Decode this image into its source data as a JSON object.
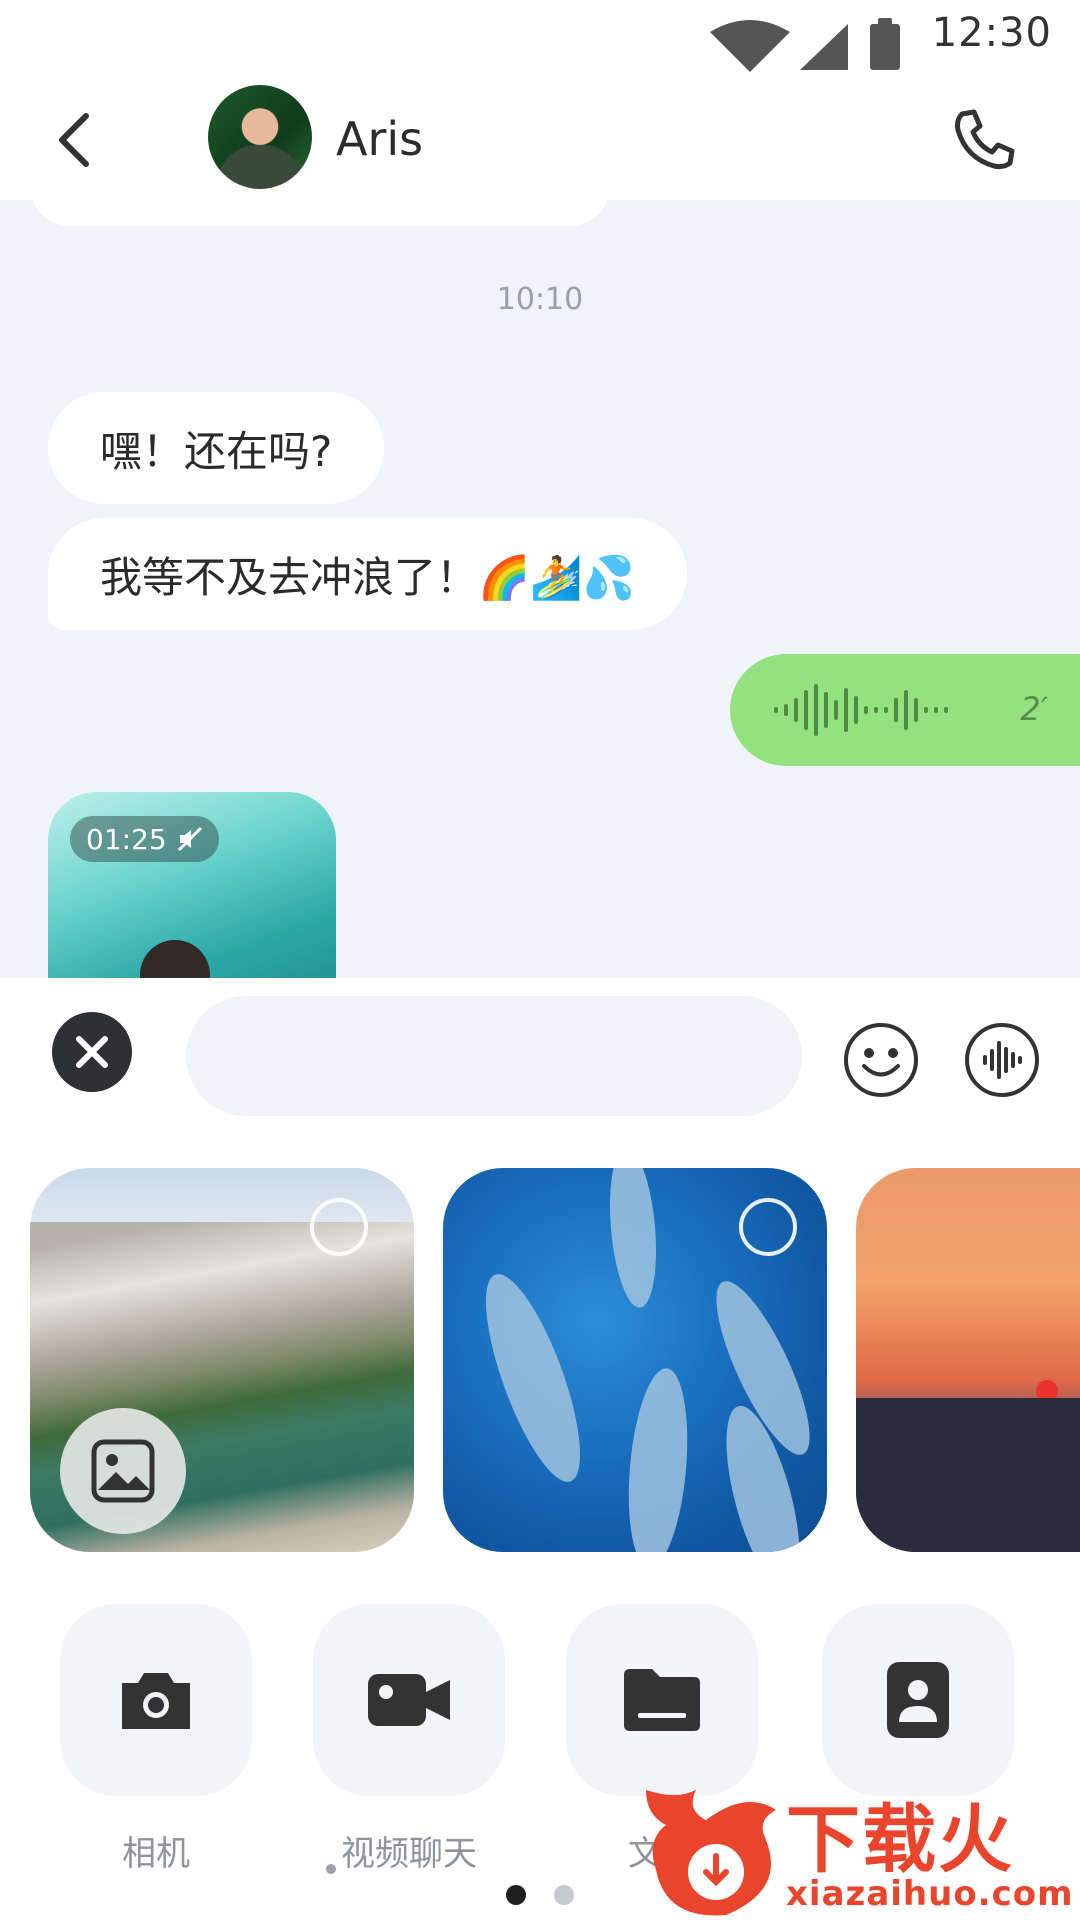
{
  "status_bar": {
    "time": "12:30"
  },
  "header": {
    "contact_name": "Aris"
  },
  "chat": {
    "timestamp": "10:10",
    "messages": [
      {
        "direction": "incoming",
        "text": "嘿！还在吗?"
      },
      {
        "direction": "incoming",
        "text": "我等不及去冲浪了！🌈🏄💦"
      }
    ],
    "voice_message": {
      "duration": "2′"
    },
    "video_message": {
      "duration": "01:25"
    }
  },
  "composer": {
    "input_value": "",
    "input_placeholder": ""
  },
  "actions": [
    {
      "label": "相机",
      "icon": "camera-icon"
    },
    {
      "label": "视频聊天",
      "icon": "video-camera-icon"
    },
    {
      "label": "文件",
      "icon": "folder-icon"
    },
    {
      "label": "",
      "icon": "contact-card-icon"
    }
  ],
  "watermark": {
    "title": "下载火",
    "url": "xiazaihuo.com"
  },
  "colors": {
    "accent_green": "#93e27f",
    "chat_bg": "#f0f3f7",
    "watermark_red": "#e8452c"
  }
}
